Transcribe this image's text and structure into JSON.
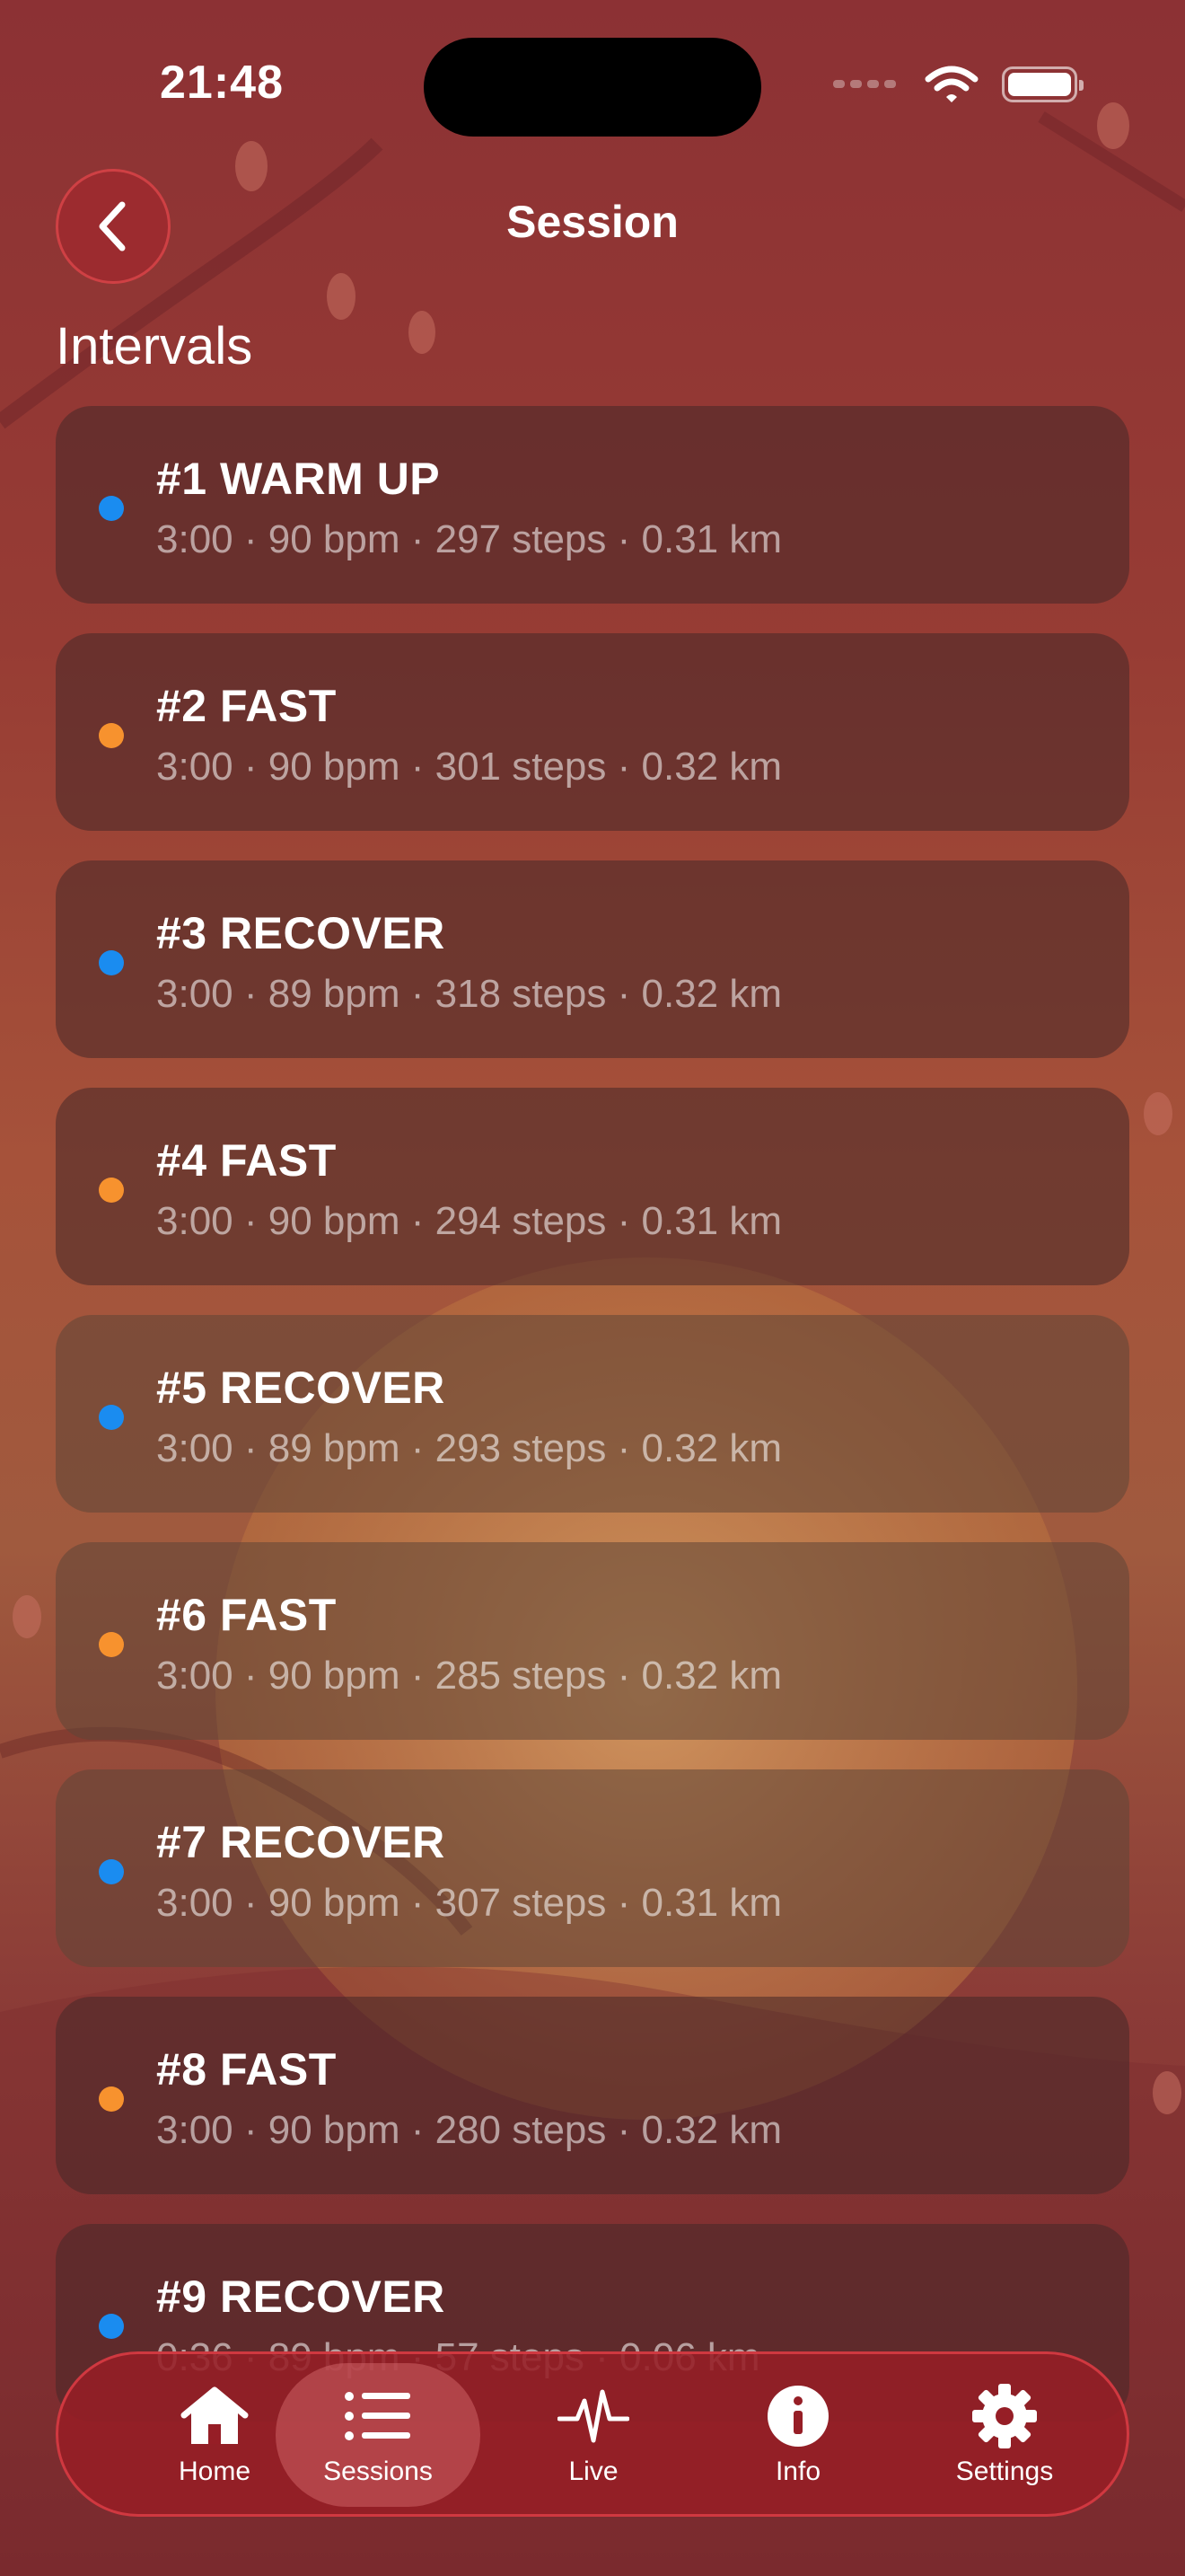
{
  "status_bar": {
    "time": "21:48"
  },
  "nav": {
    "title": "Session"
  },
  "section": {
    "title": "Intervals"
  },
  "colors": {
    "blue_dot": "#1a8cf0",
    "orange_dot": "#f7922e",
    "accent": "#c83a40"
  },
  "intervals": [
    {
      "title": "#1 WARM UP",
      "details": "3:00 · 90 bpm · 297 steps · 0.31 km",
      "dot": "blue"
    },
    {
      "title": "#2 FAST",
      "details": "3:00 · 90 bpm · 301 steps · 0.32 km",
      "dot": "orange"
    },
    {
      "title": "#3 RECOVER",
      "details": "3:00 · 89 bpm · 318 steps · 0.32 km",
      "dot": "blue"
    },
    {
      "title": "#4 FAST",
      "details": "3:00 · 90 bpm · 294 steps · 0.31 km",
      "dot": "orange"
    },
    {
      "title": "#5 RECOVER",
      "details": "3:00 · 89 bpm · 293 steps · 0.32 km",
      "dot": "blue"
    },
    {
      "title": "#6 FAST",
      "details": "3:00 · 90 bpm · 285 steps · 0.32 km",
      "dot": "orange"
    },
    {
      "title": "#7 RECOVER",
      "details": "3:00 · 90 bpm · 307 steps · 0.31 km",
      "dot": "blue"
    },
    {
      "title": "#8 FAST",
      "details": "3:00 · 90 bpm · 280 steps · 0.32 km",
      "dot": "orange"
    },
    {
      "title": "#9 RECOVER",
      "details": "0:36 · 89 bpm · 57 steps · 0.06 km",
      "dot": "blue"
    }
  ],
  "tabs": [
    {
      "label": "Home",
      "icon": "house-icon"
    },
    {
      "label": "Sessions",
      "icon": "list-icon",
      "active": true
    },
    {
      "label": "Live",
      "icon": "heartbeat-icon"
    },
    {
      "label": "Info",
      "icon": "info-icon"
    },
    {
      "label": "Settings",
      "icon": "gear-icon"
    }
  ]
}
